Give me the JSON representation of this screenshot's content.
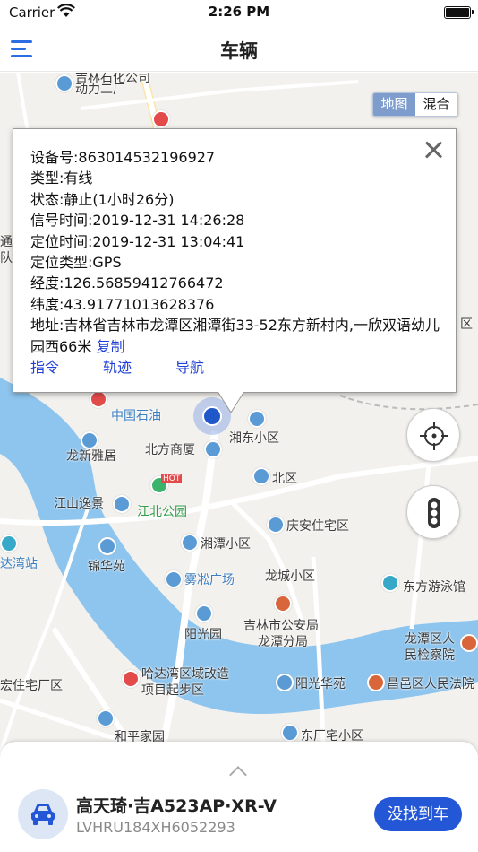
{
  "status_bar": {
    "carrier": "Carrier",
    "time": "2:26 PM"
  },
  "nav": {
    "title": "车辆",
    "menu_icon": "hamburger-menu-icon"
  },
  "map": {
    "toggle": {
      "map_label": "地图",
      "mixed_label": "混合",
      "active": "map"
    },
    "labels": {
      "top1": "吉林石化公司",
      "top2": "动力二厂",
      "left1": "通",
      "left2": "队",
      "right_qu": "区",
      "sinopec": "中国石油",
      "xiangdong": "湘东小区",
      "beifang": "北方商厦",
      "longxin": "龙新雅居",
      "beiqu": "北区",
      "jiangshan": "江山逸景",
      "jiangbei": "江北公园",
      "qingan": "庆安住宅区",
      "dawan": "达湾站",
      "xiangtan": "湘潭小区",
      "jinhua": "锦华苑",
      "wusong": "雾凇广场",
      "longcheng": "龙城小区",
      "dongfang_swim": "东方游泳馆",
      "gongan1": "吉林市公安局",
      "gongan2": "龙潭分局",
      "yangguang": "阳光园",
      "longtan_jc1": "龙潭区人",
      "longtan_jc2": "民检察院",
      "hada1": "哈达湾区域改造",
      "hada2": "项目起步区",
      "yangguang_hy": "阳光华苑",
      "changyi": "昌邑区人民法院",
      "zhuzhai": "宏住宅厂区",
      "heping": "和平家园",
      "dongchang": "东厂宅小区",
      "hot": "HOT"
    },
    "colors": {
      "river": "#8ec5ee",
      "road": "#ffffff",
      "land": "#f3f1ed",
      "accent": "#2457d6"
    }
  },
  "popup": {
    "device_label": "设备号:",
    "device_value": "863014532196927",
    "type_label": "类型:",
    "type_value": "有线",
    "status_label": "状态:",
    "status_value": "静止(1小时26分)",
    "signal_label": "信号时间:",
    "signal_value": "2019-12-31 14:26:28",
    "locate_time_label": "定位时间:",
    "locate_time_value": "2019-12-31 13:04:41",
    "locate_type_label": "定位类型:",
    "locate_type_value": "GPS",
    "lng_label": "经度:",
    "lng_value": "126.56859412766472",
    "lat_label": "纬度:",
    "lat_value": "43.91771013628376",
    "address_label": "地址:",
    "address_value": "吉林省吉林市龙潭区湘潭街33-52东方新村内,一欣双语幼儿园西66米",
    "copy_label": "复制",
    "actions": [
      "指令",
      "轨迹",
      "导航"
    ]
  },
  "vehicle": {
    "name": "高天琦·吉A523AP·XR-V",
    "vin": "LVHRU184XH6052293",
    "find_label": "没找到车"
  }
}
